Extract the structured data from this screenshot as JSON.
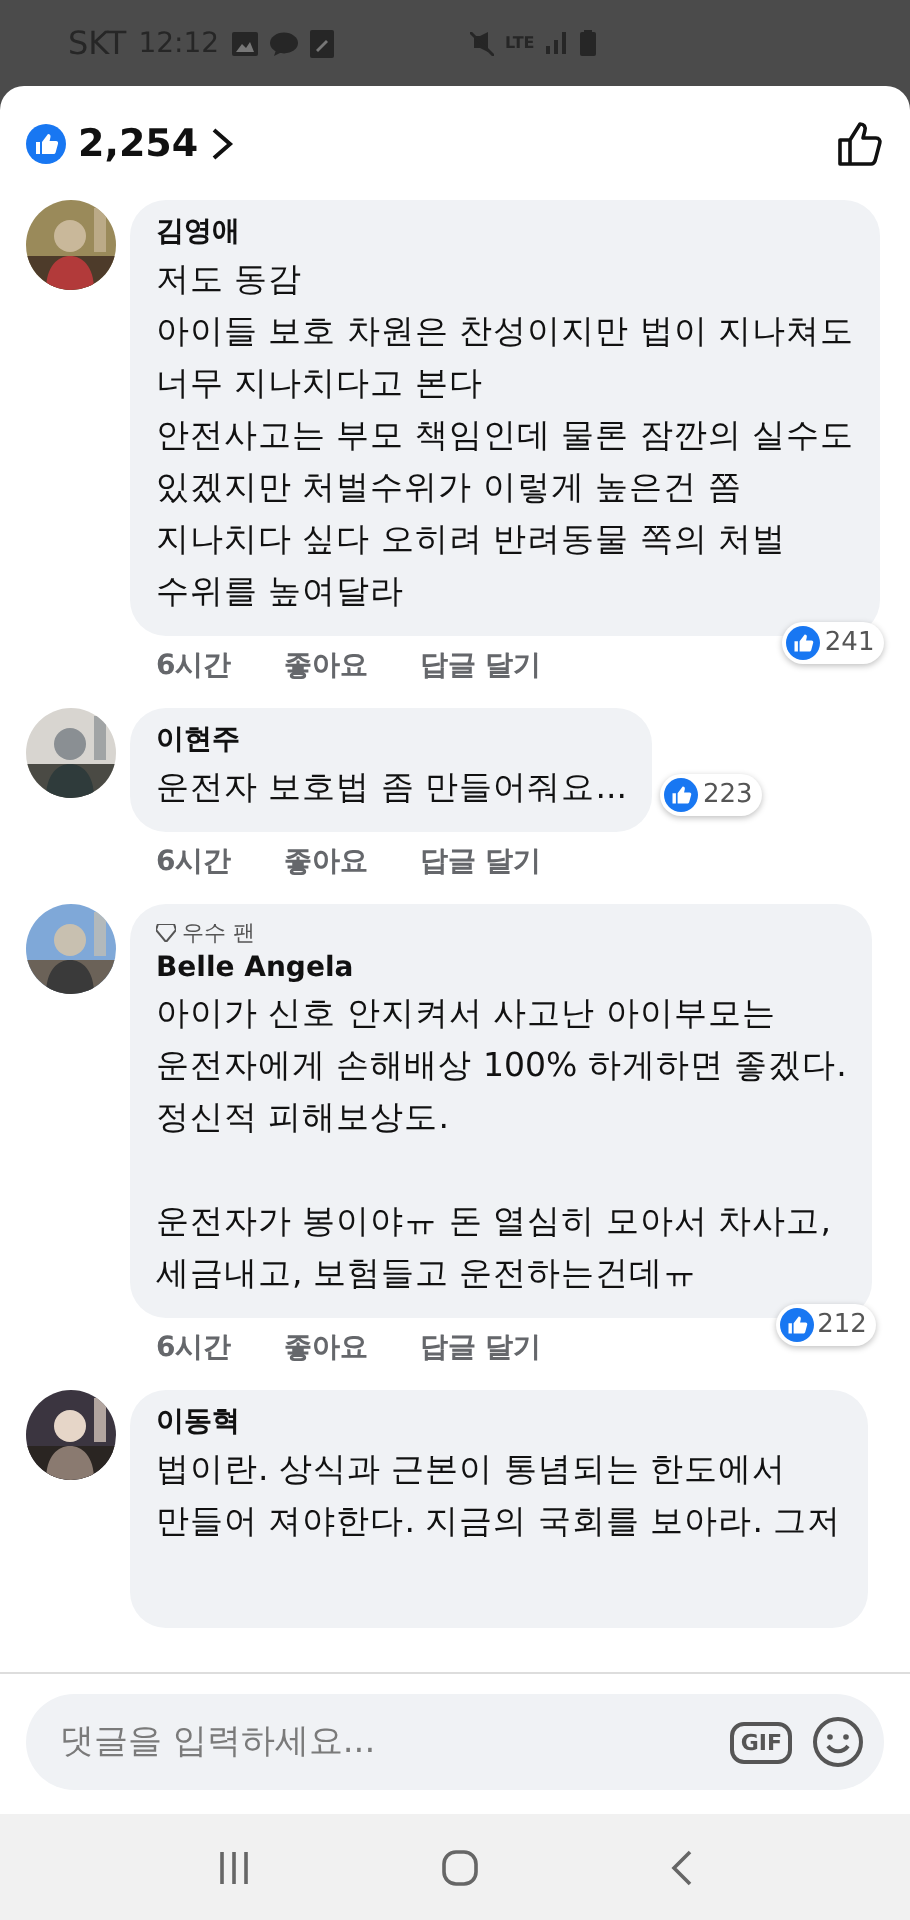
{
  "status_bar": {
    "carrier": "SKT",
    "time": "12:12",
    "network": "LTE"
  },
  "header": {
    "reaction_count": "2,254"
  },
  "comments": [
    {
      "author": "김영애",
      "text": "저도 동감\n아이들 보호 차원은 찬성이지만 법이 지나쳐도\n너무 지나치다고 본다\n안전사고는 부모 책임인데 물론 잠깐의 실수도\n있겠지만 처벌수위가 이렇게 높은건 쫌\n지나치다 싶다 오히려 반려동물 쪽의 처벌\n수위를 높여달라",
      "reactions": {
        "count": "241",
        "kind": "overlap"
      },
      "actions": [
        "6시간",
        "좋아요",
        "답글 달기"
      ]
    },
    {
      "author": "이현주",
      "text": "운전자 보호법 좀 만들어줘요...",
      "reactions": {
        "count": "223",
        "kind": "beside"
      },
      "actions": [
        "6시간",
        "좋아요",
        "답글 달기"
      ]
    },
    {
      "author": "Belle Angela",
      "badge": "우수 팬",
      "text": "아이가 신호 안지켜서 사고난 아이부모는\n운전자에게 손해배상 100% 하게하면 좋겠다.\n정신적 피해보상도.\n\n운전자가 봉이야ㅠ 돈 열심히 모아서 차사고,\n세금내고, 보험들고 운전하는건데ㅠ",
      "reactions": {
        "count": "212",
        "kind": "overlap"
      },
      "actions": [
        "6시간",
        "좋아요",
        "답글 달기"
      ]
    },
    {
      "author": "이동혁",
      "text": "법이란. 상식과 근본이 통념되는 한도에서\n만들어 져야한다. 지금의 국회를 보아라. 그저"
    }
  ],
  "composer": {
    "placeholder": "댓글을 입력하세요...",
    "gif_label": "GIF"
  }
}
